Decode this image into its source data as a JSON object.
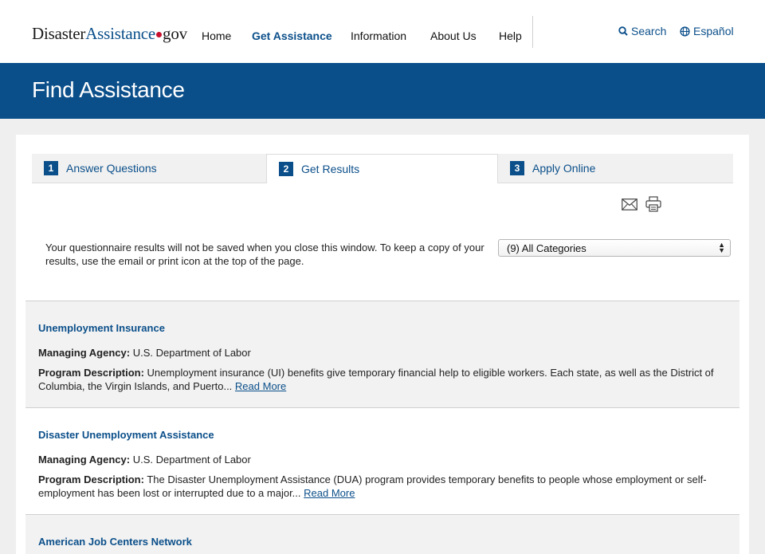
{
  "header": {
    "logo": {
      "part1": "Disaster",
      "part2": "Assistance",
      "part3": "gov"
    },
    "nav": [
      {
        "label": "Home"
      },
      {
        "label": "Get Assistance"
      },
      {
        "label": "Information"
      },
      {
        "label": "About Us"
      },
      {
        "label": "Help"
      }
    ],
    "search_label": "Search",
    "language_label": "Español"
  },
  "banner": {
    "title": "Find Assistance"
  },
  "steps": [
    {
      "number": "1",
      "label": "Answer Questions"
    },
    {
      "number": "2",
      "label": "Get Results"
    },
    {
      "number": "3",
      "label": "Apply Online"
    }
  ],
  "notice": "Your questionnaire results will not be saved when you close this window. To keep a copy of your results, use the email or print icon at the top of the page.",
  "category_select": {
    "value": "(9) All Categories"
  },
  "results": [
    {
      "title": "Unemployment Insurance",
      "agency_label": "Managing Agency:",
      "agency": "U.S. Department of Labor",
      "description_label": "Program Description:",
      "description": "Unemployment insurance (UI) benefits give temporary financial help to eligible workers. Each state, as well as the District of Columbia, the Virgin Islands, and Puerto...",
      "read_more": "Read More"
    },
    {
      "title": "Disaster Unemployment Assistance",
      "agency_label": "Managing Agency:",
      "agency": "U.S. Department of Labor",
      "description_label": "Program Description:",
      "description": "The Disaster Unemployment Assistance (DUA) program provides temporary benefits to people whose employment or self-employment has been lost or interrupted due to a major...",
      "read_more": "Read More"
    },
    {
      "title": "American Job Centers Network"
    }
  ],
  "colors": {
    "brand_blue": "#0b4f8a",
    "accent_red": "#c8102e"
  },
  "icons": [
    "search-icon",
    "globe-icon",
    "email-icon",
    "print-icon"
  ]
}
